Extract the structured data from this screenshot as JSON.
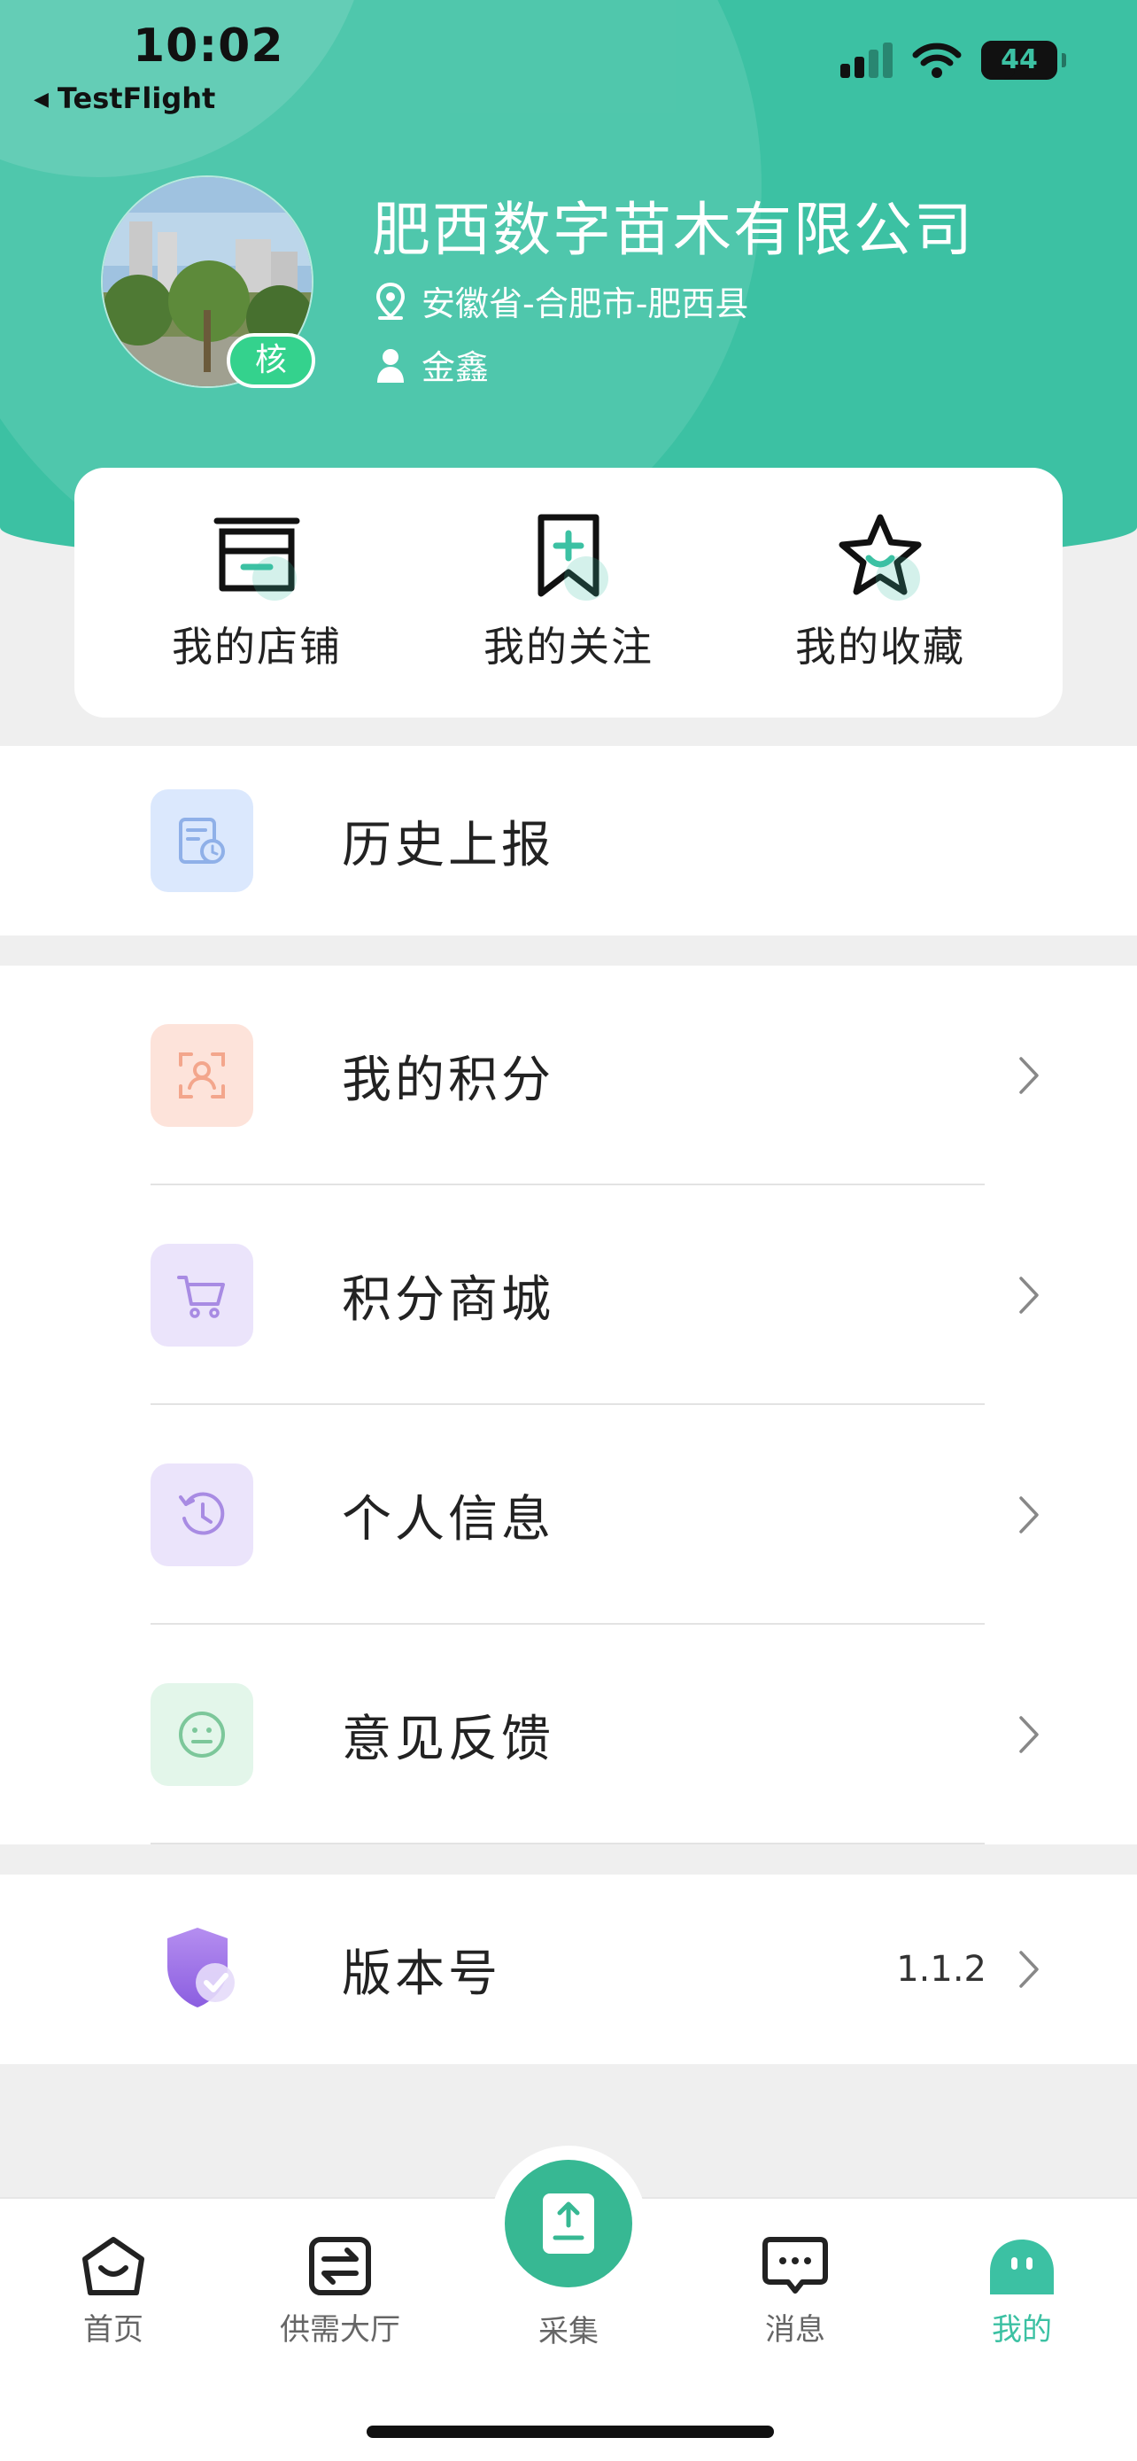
{
  "status_bar": {
    "time": "10:02",
    "back_app": "TestFlight",
    "battery": "44",
    "battery_level_percent": 44
  },
  "profile": {
    "company_name": "肥西数字苗木有限公司",
    "location": "安徽省-合肥市-肥西县",
    "person": "金鑫",
    "badge": "核"
  },
  "quick_actions": [
    {
      "label": "我的店铺",
      "icon": "storefront-icon"
    },
    {
      "label": "我的关注",
      "icon": "bookmark-plus-icon"
    },
    {
      "label": "我的收藏",
      "icon": "star-icon"
    }
  ],
  "menu": {
    "history": {
      "label": "历史上报",
      "icon": "report-history-icon"
    },
    "items": [
      {
        "label": "我的积分",
        "icon": "points-user-icon"
      },
      {
        "label": "积分商城",
        "icon": "cart-icon"
      },
      {
        "label": "个人信息",
        "icon": "clock-history-icon"
      },
      {
        "label": "意见反馈",
        "icon": "smile-feedback-icon"
      }
    ],
    "version": {
      "label": "版本号",
      "value": "1.1.2",
      "icon": "shield-check-icon"
    }
  },
  "tab_bar": {
    "tabs": [
      {
        "label": "首页",
        "icon": "home-icon"
      },
      {
        "label": "供需大厅",
        "icon": "exchange-icon"
      },
      {
        "label": "采集",
        "icon": "upload-doc-icon"
      },
      {
        "label": "消息",
        "icon": "chat-icon"
      },
      {
        "label": "我的",
        "icon": "profile-face-icon",
        "active": true
      }
    ]
  },
  "colors": {
    "brand": "#3cc1a3",
    "badge": "#34d28d"
  }
}
